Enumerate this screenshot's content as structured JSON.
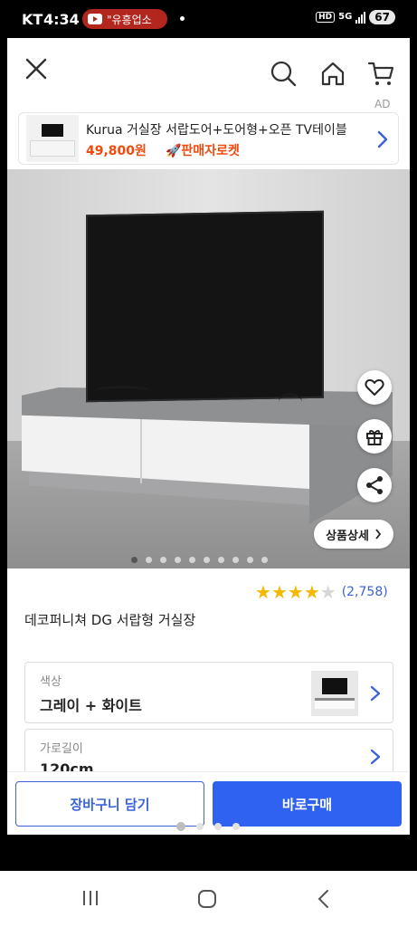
{
  "status_bar": {
    "carrier": "KT",
    "time": "4:34",
    "notification": "\"유흥업소",
    "network": "5G",
    "hd": "HD",
    "battery": "67"
  },
  "header": {
    "ad_label": "AD"
  },
  "ad_banner": {
    "title": "Kurua 거실장 서랍도어+도어형+오픈 TV테이블",
    "price": "49,800원",
    "badge": "🚀판매자로켓"
  },
  "hero": {
    "detail_button": "상품상세",
    "image_count": 10,
    "active_image": 1
  },
  "product": {
    "rating": 4,
    "rating_max": 5,
    "review_count": "(2,758)",
    "name": "데코퍼니쳐 DG 서랍형 거실장"
  },
  "options": {
    "color_label": "색상",
    "color_value": "그레이 + 화이트",
    "width_label": "가로길이",
    "width_value": "120cm"
  },
  "actions": {
    "add_to_cart": "장바구니 담기",
    "buy_now": "바로구매"
  },
  "colors": {
    "accent": "#2f62f0",
    "price": "#f04a0e",
    "star": "#f5b800"
  }
}
